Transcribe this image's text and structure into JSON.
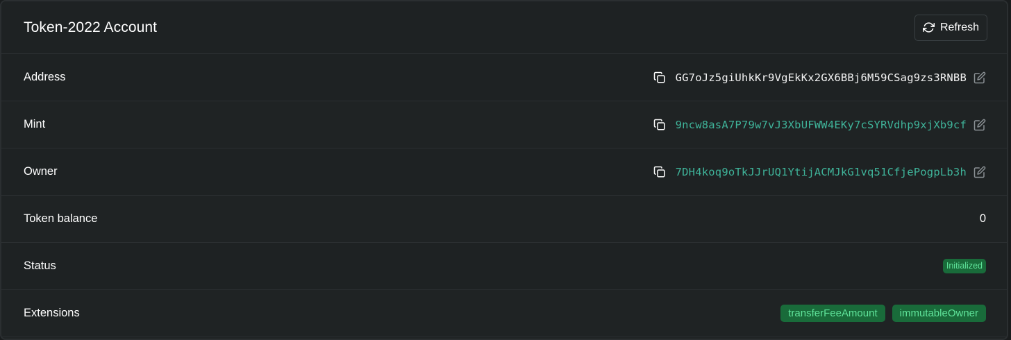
{
  "header": {
    "title": "Token-2022 Account",
    "refresh_label": "Refresh"
  },
  "rows": {
    "address": {
      "label": "Address",
      "value": "GG7oJz5giUhkKr9VgEkKx2GX6BBj6M59CSag9zs3RNBB"
    },
    "mint": {
      "label": "Mint",
      "value": "9ncw8asA7P79w7vJ3XbUFWW4EKy7cSYRVdhp9xjXb9cf"
    },
    "owner": {
      "label": "Owner",
      "value": "7DH4koq9oTkJJrUQ1YtijACMJkG1vq51CfjePogpLb3h"
    },
    "token_balance": {
      "label": "Token balance",
      "value": "0"
    },
    "status": {
      "label": "Status",
      "value": "Initialized"
    },
    "extensions": {
      "label": "Extensions",
      "items": [
        "transferFeeAmount",
        "immutableOwner"
      ]
    }
  },
  "icons": {
    "refresh": "refresh-icon",
    "copy": "copy-icon",
    "external": "edit-icon"
  },
  "colors": {
    "link": "#3fb49a",
    "badge_bg": "#196b3a",
    "badge_text": "#5fe39a"
  }
}
